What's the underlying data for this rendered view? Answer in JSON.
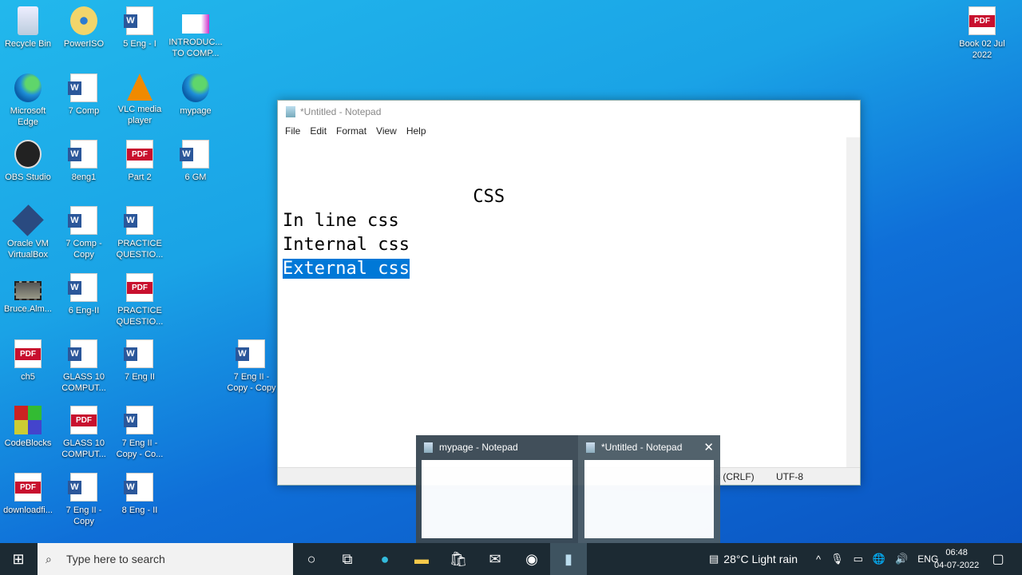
{
  "desktop_icons": [
    {
      "label": "Recycle Bin",
      "type": "bin"
    },
    {
      "label": "PowerISO",
      "type": "iso"
    },
    {
      "label": "5 Eng - I",
      "type": "word"
    },
    {
      "label": "INTRODUC... TO COMP...",
      "type": "ppt"
    },
    {
      "label": "Microsoft Edge",
      "type": "edge"
    },
    {
      "label": "7 Comp",
      "type": "word"
    },
    {
      "label": "VLC media player",
      "type": "vlc"
    },
    {
      "label": "mypage",
      "type": "edge"
    },
    {
      "label": "OBS Studio",
      "type": "obs"
    },
    {
      "label": "8eng1",
      "type": "word"
    },
    {
      "label": "Part 2",
      "type": "pdf"
    },
    {
      "label": "6 GM",
      "type": "word"
    },
    {
      "label": "Oracle VM VirtualBox",
      "type": "vbox"
    },
    {
      "label": "7 Comp - Copy",
      "type": "word"
    },
    {
      "label": "PRACTICE QUESTIO...",
      "type": "word"
    },
    {
      "label": "Bruce.Alm...",
      "type": "video"
    },
    {
      "label": "6 Eng-II",
      "type": "word"
    },
    {
      "label": "PRACTICE QUESTIO...",
      "type": "pdf"
    },
    {
      "label": "ch5",
      "type": "pdf"
    },
    {
      "label": "GLASS 10 COMPUT...",
      "type": "word"
    },
    {
      "label": "7 Eng II",
      "type": "word"
    },
    {
      "label": "7 Eng II - Copy - Copy",
      "type": "word"
    },
    {
      "label": "CodeBlocks",
      "type": "cb"
    },
    {
      "label": "GLASS 10 COMPUT...",
      "type": "pdf"
    },
    {
      "label": "7 Eng II - Copy - Co...",
      "type": "word"
    },
    {
      "label": "downloadfi...",
      "type": "pdf"
    },
    {
      "label": "7 Eng II - Copy",
      "type": "word"
    },
    {
      "label": "8 Eng - II",
      "type": "word"
    },
    {
      "label": "Book 02 Jul 2022",
      "type": "pdf"
    }
  ],
  "notepad": {
    "title": "*Untitled - Notepad",
    "menu": [
      "File",
      "Edit",
      "Format",
      "View",
      "Help"
    ],
    "lines": [
      "                  CSS",
      "In line css",
      "Internal css"
    ],
    "selected_line": "External css",
    "status": {
      "eol": "s (CRLF)",
      "encoding": "UTF-8"
    }
  },
  "preview": {
    "items": [
      {
        "title": "mypage - Notepad"
      },
      {
        "title": "*Untitled - Notepad"
      }
    ],
    "close": "✕"
  },
  "taskbar": {
    "search_placeholder": "Type here to search",
    "weather": "28°C  Light rain",
    "lang": "ENG",
    "time": "06:48",
    "date": "04-07-2022"
  }
}
